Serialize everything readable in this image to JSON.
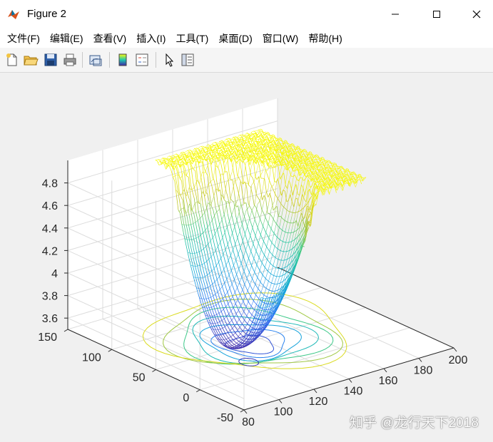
{
  "window": {
    "title": "Figure 2"
  },
  "menu": [
    "文件(F)",
    "编辑(E)",
    "查看(V)",
    "插入(I)",
    "工具(T)",
    "桌面(D)",
    "窗口(W)",
    "帮助(H)"
  ],
  "toolbar_icons": [
    "new-figure-icon",
    "open-file-icon",
    "save-icon",
    "print-icon",
    "link-plot-icon",
    "colorbar-icon",
    "legend-icon",
    "pointer-icon",
    "property-editor-icon"
  ],
  "watermark": "知乎 @龙行天下2018",
  "chart_data": {
    "type": "surface-mesh-with-contour",
    "x_ticks": [
      80,
      100,
      120,
      140,
      160,
      180,
      200
    ],
    "y_ticks": [
      -50,
      0,
      50,
      100,
      150
    ],
    "z_ticks": [
      3.6,
      3.8,
      4,
      4.2,
      4.4,
      4.6,
      4.8
    ],
    "x_tick_labels": [
      "80",
      "100",
      "120",
      "140",
      "160",
      "180",
      "200"
    ],
    "y_tick_labels": [
      "-50",
      "0",
      "50",
      "100",
      "150"
    ],
    "z_tick_labels": [
      "3.6",
      "3.8",
      "4",
      "4.2",
      "4.4",
      "4.6",
      "4.8"
    ],
    "xlim": [
      80,
      200
    ],
    "ylim": [
      -50,
      150
    ],
    "zlim": [
      3.5,
      5.0
    ],
    "grid": true,
    "colormap": "parula",
    "surface": {
      "x_range": [
        115,
        175
      ],
      "y_range": [
        0,
        120
      ],
      "min_point": {
        "x": 120,
        "y": 40,
        "z": 3.55
      },
      "max_z": 4.95
    },
    "contour_levels": 7,
    "colors": {
      "low": "#3e26a8",
      "mid": "#1fc8b0",
      "high": "#f9fb0e"
    }
  }
}
